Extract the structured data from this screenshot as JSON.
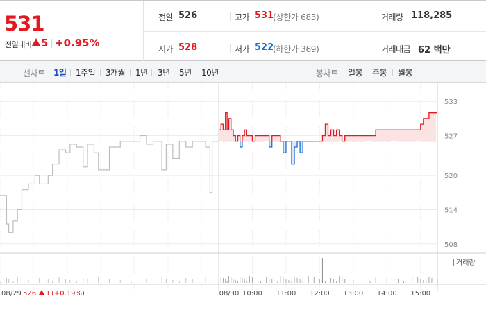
{
  "summary": {
    "current_price": "531",
    "change_label": "전일대비",
    "change_value": "5",
    "change_pct": "+0.95%"
  },
  "stats": {
    "prev_close_label": "전일",
    "prev_close": "526",
    "high_label": "고가",
    "high": "531",
    "upper_limit": "(상한가 683)",
    "volume_label": "거래량",
    "volume": "118,285",
    "open_label": "시가",
    "open": "528",
    "low_label": "저가",
    "low": "522",
    "lower_limit": "(하한가 369)",
    "turnover_label": "거래대금",
    "turnover": "62 백만"
  },
  "toolbar": {
    "line_chart_title": "선차트",
    "line_periods": [
      "1일",
      "1주일",
      "3개월",
      "1년",
      "3년",
      "5년",
      "10년"
    ],
    "active_period": "1일",
    "candle_chart_title": "봉차트",
    "candle_periods": [
      "일봉",
      "주봉",
      "월봉"
    ]
  },
  "colors": {
    "up": "#e2191f",
    "down": "#1a6dd3",
    "prev_day_line": "#bdbdbd",
    "volume": "#a9a9a9"
  },
  "chart_data": {
    "type": "line",
    "y_ticks": [
      533,
      527,
      520,
      514,
      508
    ],
    "ylim": [
      507,
      534
    ],
    "base_price": 526,
    "x_labels": [
      "08/30",
      "10:00",
      "11:00",
      "12:00",
      "13:00",
      "14:00",
      "15:00"
    ],
    "prev_day_label": "08/29",
    "prev_day_close": "526",
    "prev_day_change": "1",
    "prev_day_change_pct": "(+0.19%)",
    "volume_legend": "거래량",
    "prev_day_series": [
      {
        "x": 0.0,
        "y": 516.5
      },
      {
        "x": 0.03,
        "y": 511.5
      },
      {
        "x": 0.04,
        "y": 510
      },
      {
        "x": 0.06,
        "y": 512
      },
      {
        "x": 0.08,
        "y": 514
      },
      {
        "x": 0.1,
        "y": 517.5
      },
      {
        "x": 0.13,
        "y": 518.5
      },
      {
        "x": 0.16,
        "y": 520
      },
      {
        "x": 0.18,
        "y": 518.5
      },
      {
        "x": 0.22,
        "y": 520
      },
      {
        "x": 0.24,
        "y": 522
      },
      {
        "x": 0.27,
        "y": 524.5
      },
      {
        "x": 0.3,
        "y": 524
      },
      {
        "x": 0.32,
        "y": 525.5
      },
      {
        "x": 0.35,
        "y": 525
      },
      {
        "x": 0.38,
        "y": 521.5
      },
      {
        "x": 0.4,
        "y": 525.5
      },
      {
        "x": 0.43,
        "y": 524
      },
      {
        "x": 0.45,
        "y": 521
      },
      {
        "x": 0.5,
        "y": 525
      },
      {
        "x": 0.55,
        "y": 526
      },
      {
        "x": 0.6,
        "y": 526
      },
      {
        "x": 0.64,
        "y": 527
      },
      {
        "x": 0.67,
        "y": 525.5
      },
      {
        "x": 0.7,
        "y": 526
      },
      {
        "x": 0.74,
        "y": 521
      },
      {
        "x": 0.76,
        "y": 525.5
      },
      {
        "x": 0.79,
        "y": 523
      },
      {
        "x": 0.82,
        "y": 526
      },
      {
        "x": 0.85,
        "y": 525
      },
      {
        "x": 0.88,
        "y": 526
      },
      {
        "x": 0.91,
        "y": 526
      },
      {
        "x": 0.94,
        "y": 525
      },
      {
        "x": 0.96,
        "y": 517
      },
      {
        "x": 0.97,
        "y": 526
      },
      {
        "x": 1.0,
        "y": 526
      }
    ],
    "today_series": [
      {
        "t": "09:00",
        "y": 528
      },
      {
        "t": "09:04",
        "y": 529
      },
      {
        "t": "09:08",
        "y": 528
      },
      {
        "t": "09:12",
        "y": 531
      },
      {
        "t": "09:15",
        "y": 528
      },
      {
        "t": "09:18",
        "y": 530
      },
      {
        "t": "09:22",
        "y": 528
      },
      {
        "t": "09:26",
        "y": 527
      },
      {
        "t": "09:30",
        "y": 526
      },
      {
        "t": "09:34",
        "y": 527
      },
      {
        "t": "09:38",
        "y": 525
      },
      {
        "t": "09:42",
        "y": 527
      },
      {
        "t": "09:46",
        "y": 528
      },
      {
        "t": "09:50",
        "y": 527
      },
      {
        "t": "09:55",
        "y": 527
      },
      {
        "t": "10:00",
        "y": 526
      },
      {
        "t": "10:05",
        "y": 527
      },
      {
        "t": "10:10",
        "y": 527
      },
      {
        "t": "10:15",
        "y": 527
      },
      {
        "t": "10:25",
        "y": 527
      },
      {
        "t": "10:30",
        "y": 525
      },
      {
        "t": "10:35",
        "y": 527
      },
      {
        "t": "10:45",
        "y": 527
      },
      {
        "t": "10:50",
        "y": 526
      },
      {
        "t": "10:55",
        "y": 524
      },
      {
        "t": "11:00",
        "y": 526
      },
      {
        "t": "11:05",
        "y": 526
      },
      {
        "t": "11:10",
        "y": 522
      },
      {
        "t": "11:15",
        "y": 525
      },
      {
        "t": "11:20",
        "y": 526
      },
      {
        "t": "11:25",
        "y": 524
      },
      {
        "t": "11:30",
        "y": 526
      },
      {
        "t": "11:40",
        "y": 526
      },
      {
        "t": "11:50",
        "y": 526
      },
      {
        "t": "12:00",
        "y": 526
      },
      {
        "t": "12:05",
        "y": 527
      },
      {
        "t": "12:10",
        "y": 529
      },
      {
        "t": "12:15",
        "y": 527
      },
      {
        "t": "12:20",
        "y": 528
      },
      {
        "t": "12:25",
        "y": 527
      },
      {
        "t": "12:30",
        "y": 528
      },
      {
        "t": "12:35",
        "y": 527
      },
      {
        "t": "12:40",
        "y": 526
      },
      {
        "t": "12:45",
        "y": 527
      },
      {
        "t": "13:00",
        "y": 527
      },
      {
        "t": "13:30",
        "y": 527
      },
      {
        "t": "13:40",
        "y": 528
      },
      {
        "t": "14:00",
        "y": 528
      },
      {
        "t": "14:20",
        "y": 528
      },
      {
        "t": "14:30",
        "y": 528
      },
      {
        "t": "14:45",
        "y": 528
      },
      {
        "t": "14:55",
        "y": 528
      },
      {
        "t": "15:00",
        "y": 529
      },
      {
        "t": "15:05",
        "y": 530
      },
      {
        "t": "15:10",
        "y": 530
      },
      {
        "t": "15:15",
        "y": 531
      },
      {
        "t": "15:20",
        "y": 531
      },
      {
        "t": "15:30",
        "y": 531
      }
    ]
  }
}
